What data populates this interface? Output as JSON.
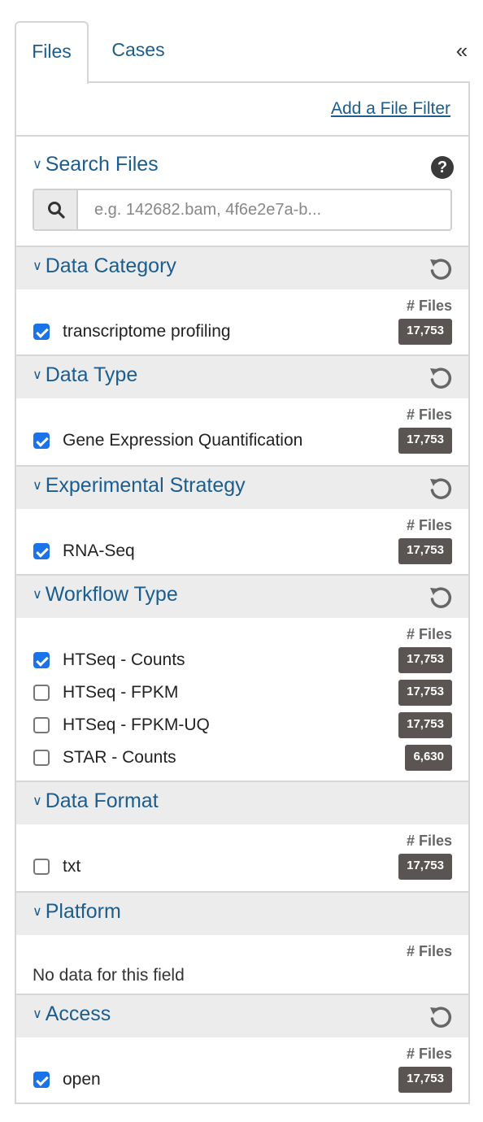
{
  "tabs": [
    {
      "label": "Files"
    },
    {
      "label": "Cases"
    }
  ],
  "collapse_label": "«",
  "add_filter_label": "Add a File Filter",
  "search": {
    "title": "Search Files",
    "placeholder": "e.g. 142682.bam, 4f6e2e7a-b..."
  },
  "files_col_label": "# Files",
  "facets": {
    "data_category": {
      "title": "Data Category",
      "items": [
        {
          "label": "transcriptome profiling",
          "count": "17,753",
          "checked": true
        }
      ]
    },
    "data_type": {
      "title": "Data Type",
      "items": [
        {
          "label": "Gene Expression Quantification",
          "count": "17,753",
          "checked": true
        }
      ]
    },
    "experimental_strategy": {
      "title": "Experimental Strategy",
      "items": [
        {
          "label": "RNA-Seq",
          "count": "17,753",
          "checked": true
        }
      ]
    },
    "workflow_type": {
      "title": "Workflow Type",
      "items": [
        {
          "label": "HTSeq - Counts",
          "count": "17,753",
          "checked": true
        },
        {
          "label": "HTSeq - FPKM",
          "count": "17,753",
          "checked": false
        },
        {
          "label": "HTSeq - FPKM-UQ",
          "count": "17,753",
          "checked": false
        },
        {
          "label": "STAR - Counts",
          "count": "6,630",
          "checked": false
        }
      ]
    },
    "data_format": {
      "title": "Data Format",
      "items": [
        {
          "label": "txt",
          "count": "17,753",
          "checked": false
        }
      ]
    },
    "platform": {
      "title": "Platform",
      "empty_text": "No data for this field"
    },
    "access": {
      "title": "Access",
      "items": [
        {
          "label": "open",
          "count": "17,753",
          "checked": true
        }
      ]
    }
  },
  "colors": {
    "link": "#1b5d8f",
    "checkbox_checked": "#1a73e8",
    "badge_bg": "#5a5553",
    "header_bg": "#ececec"
  }
}
